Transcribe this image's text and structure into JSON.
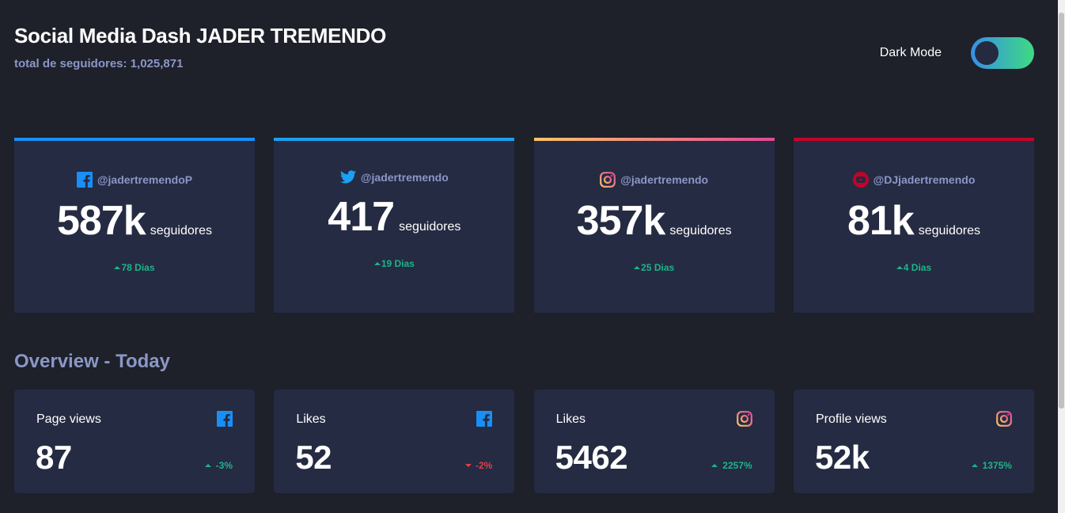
{
  "header": {
    "title": "Social Media Dash JADER TREMENDO",
    "subtitle": "total de seguidores: 1,025,871"
  },
  "theme_toggle": {
    "label": "Dark Mode",
    "state": "on"
  },
  "colors": {
    "background": "#1e202a",
    "card": "#252b42",
    "muted_text": "#8b97c6",
    "positive": "#1db489",
    "negative": "#dc414c",
    "facebook": "#198ff5",
    "twitter": "#1ca0f2",
    "instagram_gradient": [
      "#fdc468",
      "#df4996"
    ],
    "youtube": "#c4032a"
  },
  "follower_cards": [
    {
      "network": "facebook",
      "icon": "facebook-icon",
      "handle": "@jadertremendoP",
      "count": "587k",
      "unit": "seguidores",
      "delta": "78 Dias",
      "direction": "up"
    },
    {
      "network": "twitter",
      "icon": "twitter-icon",
      "handle": "@jadertremendo",
      "count": "417",
      "unit": "seguidores",
      "delta": "19 Dias",
      "direction": "up"
    },
    {
      "network": "instagram",
      "icon": "instagram-icon",
      "handle": "@jadertremendo",
      "count": "357k",
      "unit": "seguidores",
      "delta": "25 Dias",
      "direction": "up"
    },
    {
      "network": "youtube",
      "icon": "youtube-icon",
      "handle": "@DJjadertremendo",
      "count": "81k",
      "unit": "seguidores",
      "delta": "4 Dias",
      "direction": "up"
    }
  ],
  "overview": {
    "title": "Overview - Today",
    "cards": [
      {
        "label": "Page views",
        "icon": "facebook-icon",
        "value": "87",
        "delta": "-3%",
        "direction": "up"
      },
      {
        "label": "Likes",
        "icon": "facebook-icon",
        "value": "52",
        "delta": "-2%",
        "direction": "down"
      },
      {
        "label": "Likes",
        "icon": "instagram-icon",
        "value": "5462",
        "delta": "2257%",
        "direction": "up"
      },
      {
        "label": "Profile views",
        "icon": "instagram-icon",
        "value": "52k",
        "delta": "1375%",
        "direction": "up"
      }
    ]
  }
}
